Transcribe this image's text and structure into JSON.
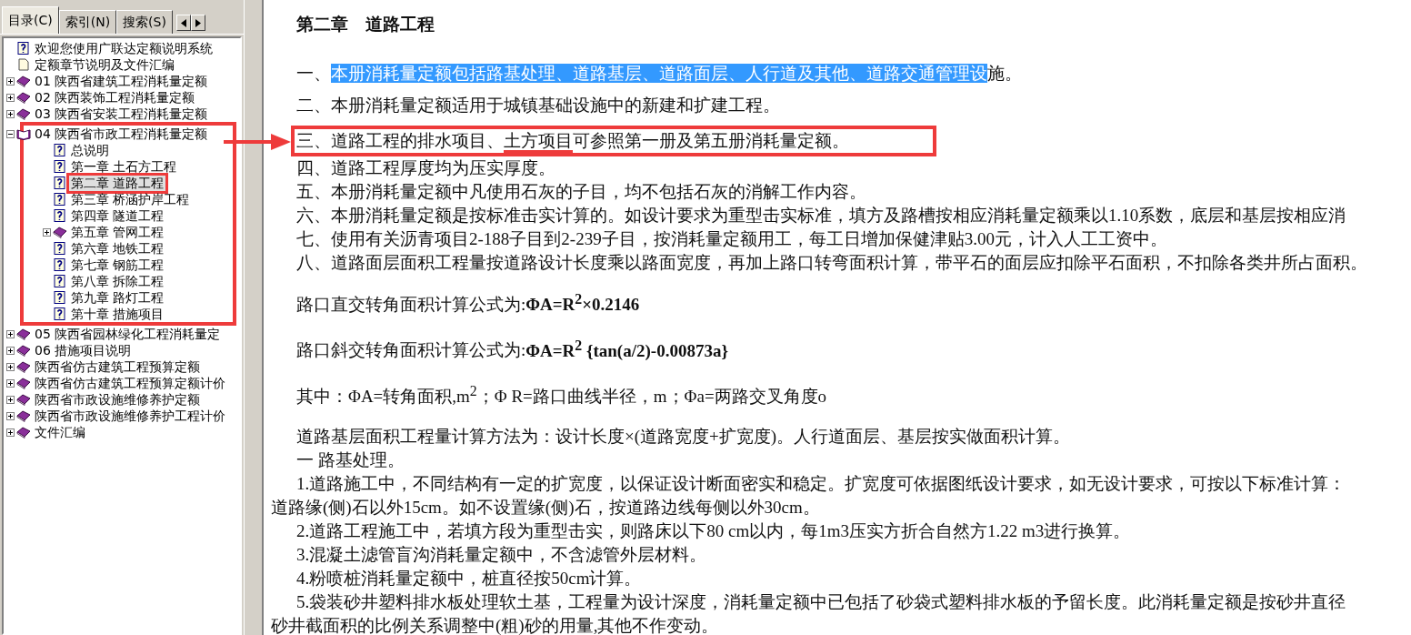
{
  "tabs": [
    {
      "label": "目录(C)",
      "selected": true
    },
    {
      "label": "索引(N)",
      "selected": false
    },
    {
      "label": "搜索(S)",
      "selected": false
    }
  ],
  "tree": [
    {
      "label": "欢迎您使用广联达定额说明系统",
      "kind": "help",
      "selected": false
    },
    {
      "label": "定额章节说明及文件汇编",
      "kind": "page",
      "selected": false
    },
    {
      "label": "01 陕西省建筑工程消耗量定额",
      "kind": "book",
      "expanded": false,
      "selected": false
    },
    {
      "label": "02 陕西装饰工程消耗量定额",
      "kind": "book",
      "expanded": false,
      "selected": false
    },
    {
      "label": "03 陕西省安装工程消耗量定额",
      "kind": "book",
      "expanded": false,
      "selected": false
    },
    {
      "label": "04 陕西省市政工程消耗量定额",
      "kind": "open-book",
      "expanded": true,
      "selected": false,
      "marked": true,
      "children": [
        {
          "label": "总说明",
          "kind": "help",
          "selected": false
        },
        {
          "label": "第一章 土石方工程",
          "kind": "help",
          "selected": false
        },
        {
          "label": "第二章 道路工程",
          "kind": "help",
          "selected": true,
          "marked": true
        },
        {
          "label": "第三章 桥涵护岸工程",
          "kind": "help",
          "selected": false
        },
        {
          "label": "第四章 隧道工程",
          "kind": "help",
          "selected": false
        },
        {
          "label": "第五章 管网工程",
          "kind": "book",
          "expanded": false,
          "selected": false
        },
        {
          "label": "第六章 地铁工程",
          "kind": "help",
          "selected": false
        },
        {
          "label": "第七章 钢筋工程",
          "kind": "help",
          "selected": false
        },
        {
          "label": "第八章 拆除工程",
          "kind": "help",
          "selected": false
        },
        {
          "label": "第九章 路灯工程",
          "kind": "help",
          "selected": false
        },
        {
          "label": "第十章 措施项目",
          "kind": "help",
          "selected": false
        }
      ]
    },
    {
      "label": "05 陕西省园林绿化工程消耗量定",
      "kind": "book",
      "expanded": false,
      "selected": false
    },
    {
      "label": "06 措施项目说明",
      "kind": "book",
      "expanded": false,
      "selected": false
    },
    {
      "label": "陕西省仿古建筑工程预算定额",
      "kind": "book",
      "expanded": false,
      "selected": false
    },
    {
      "label": "陕西省仿古建筑工程预算定额计价",
      "kind": "book",
      "expanded": false,
      "selected": false
    },
    {
      "label": "陕西省市政设施维修养护定额",
      "kind": "book",
      "expanded": false,
      "selected": false
    },
    {
      "label": "陕西省市政设施维修养护工程计价",
      "kind": "book",
      "expanded": false,
      "selected": false
    },
    {
      "label": "文件汇编",
      "kind": "book",
      "expanded": false,
      "selected": false
    }
  ],
  "document": {
    "title": "第二章　道路工程",
    "paragraphs": [
      {
        "kind": "para",
        "segments": [
          {
            "text": "一、"
          },
          {
            "text": "本册消耗量定额包括路基处理、道路基层、道路面层、人行道及其他、道路交通管理设",
            "highlighted": true
          },
          {
            "text": "施。"
          }
        ]
      },
      {
        "kind": "para",
        "segments": [
          {
            "text": "二、本册消耗量定额适用于城镇基础设施中的新建和扩建工程。"
          }
        ]
      },
      {
        "kind": "para",
        "marked": true,
        "segments": [
          {
            "text": "三、道路工程的排水项目、"
          },
          {
            "text": "土方项目",
            "underlined": true
          },
          {
            "text": "可参照第一册及第五册消耗量定额。"
          }
        ]
      },
      {
        "kind": "para",
        "segments": [
          {
            "text": "四、道路工程厚度均为压实厚度。"
          }
        ]
      },
      {
        "kind": "para",
        "segments": [
          {
            "text": "五、本册消耗量定额中凡使用石灰的子目，均不包括石灰的消解工作内容。"
          }
        ]
      },
      {
        "kind": "para",
        "segments": [
          {
            "text": "六、本册消耗量定额是按标准击实计算的。如设计要求为重型击实标准，填方及路槽按相应消耗量定额乘以1.10系数，底层和基层按相应消"
          }
        ]
      },
      {
        "kind": "para",
        "segments": [
          {
            "text": "七、使用有关沥青项目2-188子目到2-239子目，按消耗量定额用工，每工日增加保健津贴3.00元，计入人工工资中。"
          }
        ]
      },
      {
        "kind": "para",
        "segments": [
          {
            "text": "八、道路面层面积工程量按道路设计长度乘以路面宽度，再加上路口转弯面积计算，带平石的面层应扣除平石面积，不扣除各类井所占面积。"
          }
        ]
      },
      {
        "kind": "formula",
        "segments": [
          {
            "text": "路口直交转角面积计算公式为:"
          },
          {
            "text": "ΦA=R$^{2}$×0.2146",
            "formula": true
          }
        ]
      },
      {
        "kind": "formula",
        "segments": [
          {
            "text": "路口斜交转角面积计算公式为:"
          },
          {
            "text": "ΦA=R$^{2}$ {tan(a/2)-0.00873a}",
            "formula": true
          }
        ]
      },
      {
        "kind": "formula",
        "segments": [
          {
            "text": "其中：ΦA=转角面积,m$^{2}$；Φ R=路口曲线半径，m；Φa=两路交叉角度o"
          }
        ]
      },
      {
        "kind": "para",
        "segments": [
          {
            "text": "道路基层面积工程量计算方法为：设计长度×(道路宽度+扩宽度)。人行道面层、基层按实做面积计算。"
          }
        ]
      },
      {
        "kind": "para",
        "segments": [
          {
            "text": "一 路基处理。"
          }
        ]
      },
      {
        "kind": "para",
        "segments": [
          {
            "text": "1.道路施工中，不同结构有一定的扩宽度，以保证设计断面密实和稳定。扩宽度可依据图纸设计要求，如无设计要求，可按以下标准计算："
          }
        ]
      },
      {
        "kind": "continuation",
        "segments": [
          {
            "text": "道路缘(侧)石以外15cm。如不设置缘(侧)石，按道路边线每侧以外30cm。"
          }
        ]
      },
      {
        "kind": "para",
        "segments": [
          {
            "text": "2.道路工程施工中，若填方段为重型击实，则路床以下80 cm以内，每1m3压实方折合自然方1.22 m3进行换算。"
          }
        ]
      },
      {
        "kind": "para",
        "segments": [
          {
            "text": "3.混凝土滤管盲沟消耗量定额中，不含滤管外层材料。"
          }
        ]
      },
      {
        "kind": "para",
        "segments": [
          {
            "text": "4.粉喷桩消耗量定额中，桩直径按50cm计算。"
          }
        ]
      },
      {
        "kind": "para",
        "segments": [
          {
            "text": "5.袋装砂井塑料排水板处理软土基，工程量为设计深度，消耗量定额中已包括了砂袋式塑料排水板的予留长度。此消耗量定额是按砂井直径"
          }
        ]
      },
      {
        "kind": "continuation",
        "segments": [
          {
            "text": "砂井截面积的比例关系调整中(粗)砂的用量,其他不作变动。"
          }
        ]
      }
    ]
  }
}
